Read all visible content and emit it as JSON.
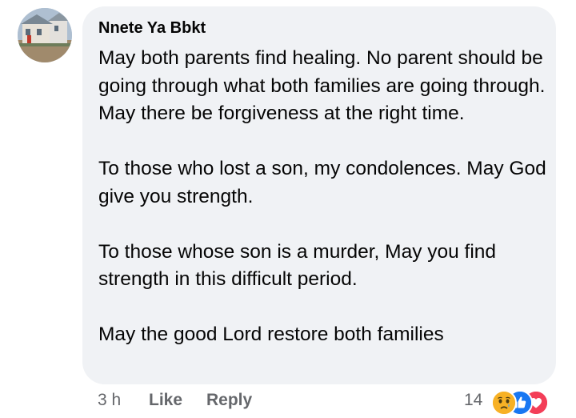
{
  "comment": {
    "author": "Nnete Ya Bbkt",
    "paragraphs": [
      "May both parents find healing. No parent should be going through what both families are going through.  May there be forgiveness at the right time.",
      "To those who lost a son, my condolences. May God give you strength.",
      "To those whose son is a murder, May you find strength in this difficult period.",
      "May the good Lord restore both families"
    ]
  },
  "footer": {
    "timestamp": "3 h",
    "like_label": "Like",
    "reply_label": "Reply",
    "reaction_count": "14",
    "reaction_icons": [
      "sad-face-icon",
      "thumbs-up-icon",
      "heart-icon"
    ]
  },
  "colors": {
    "bubble_bg": "#f0f2f5",
    "text": "#050505",
    "secondary_text": "#65676b",
    "like_blue": "#1877f2",
    "love_red": "#f33e58",
    "sad_yellow": "#f7b125"
  }
}
